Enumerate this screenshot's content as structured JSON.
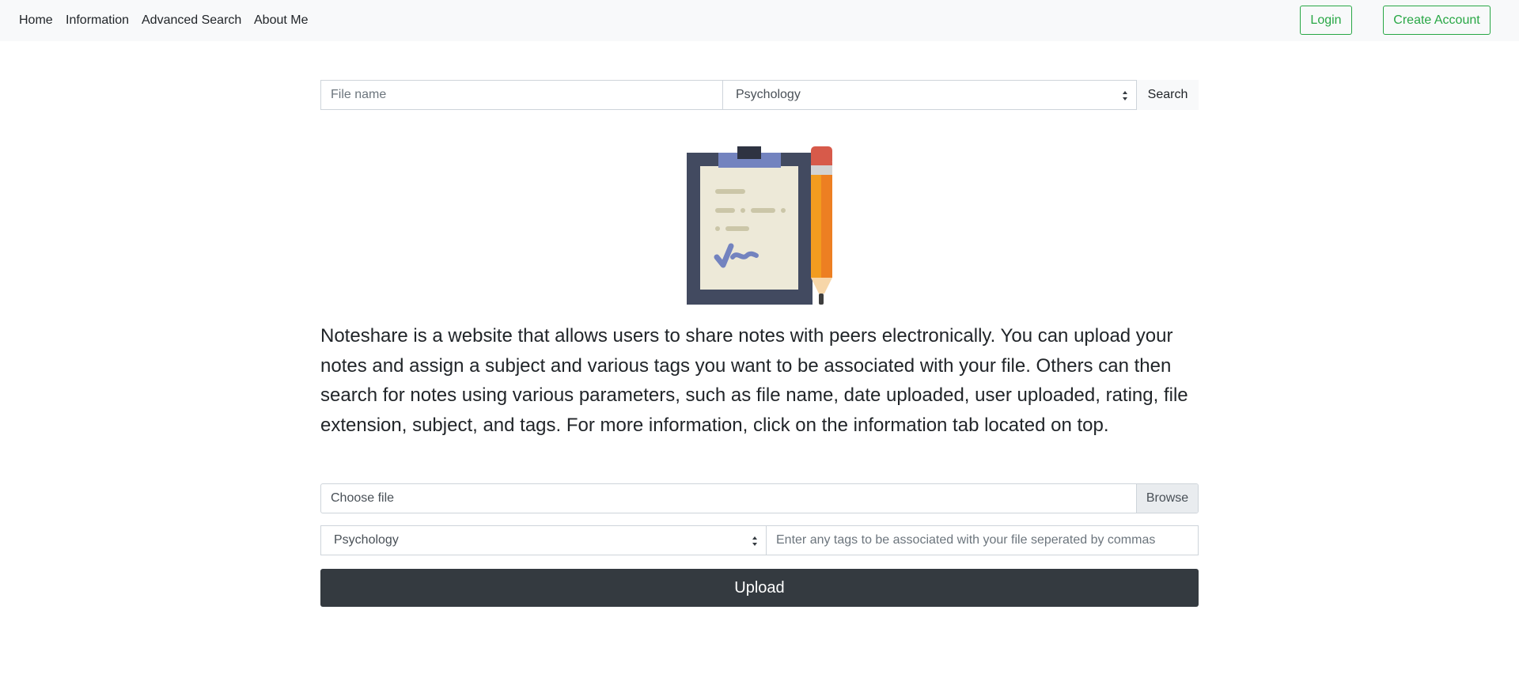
{
  "nav": {
    "links": [
      "Home",
      "Information",
      "Advanced Search",
      "About Me"
    ],
    "login_label": "Login",
    "create_account_label": "Create Account"
  },
  "search": {
    "file_name_placeholder": "File name",
    "subject_selected": "Psychology",
    "search_label": "Search"
  },
  "illustration": {
    "icon": "clipboard-pencil-icon"
  },
  "intro_text": "Noteshare is a website that allows users to share notes with peers electronically. You can upload your notes and assign a subject and various tags you want to be associated with your file. Others can then search for notes using various parameters, such as file name, date uploaded, user uploaded, rating, file extension, subject, and tags. For more information, click on the information tab located on top.",
  "upload_form": {
    "file_label": "Choose file",
    "browse_label": "Browse",
    "subject_selected": "Psychology",
    "tags_placeholder": "Enter any tags to be associated with your file seperated by commas",
    "upload_label": "Upload"
  },
  "colors": {
    "navbar_bg": "#f8f9fa",
    "accent_green": "#28a745",
    "upload_bg": "#343a40"
  }
}
